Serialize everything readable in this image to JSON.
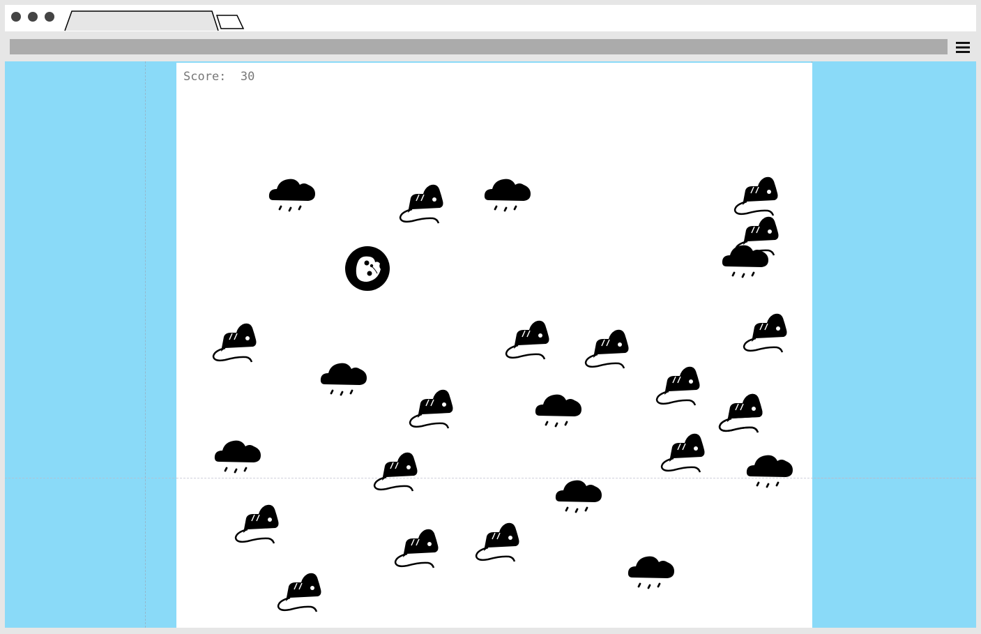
{
  "window": {
    "controls": [
      "close-dot",
      "minimize-dot",
      "maximize-dot"
    ],
    "menu_icon": "hamburger-icon"
  },
  "game": {
    "score_label": "Score:",
    "score_value": "30",
    "player_icon": "bitten-cookie-icon",
    "enemy_icon": "mouse-icon",
    "hazard_icon": "snow-cloud-icon",
    "colors": {
      "side_panel": "#8adaf8",
      "playfield": "#ffffff",
      "sprite": "#000000"
    }
  }
}
